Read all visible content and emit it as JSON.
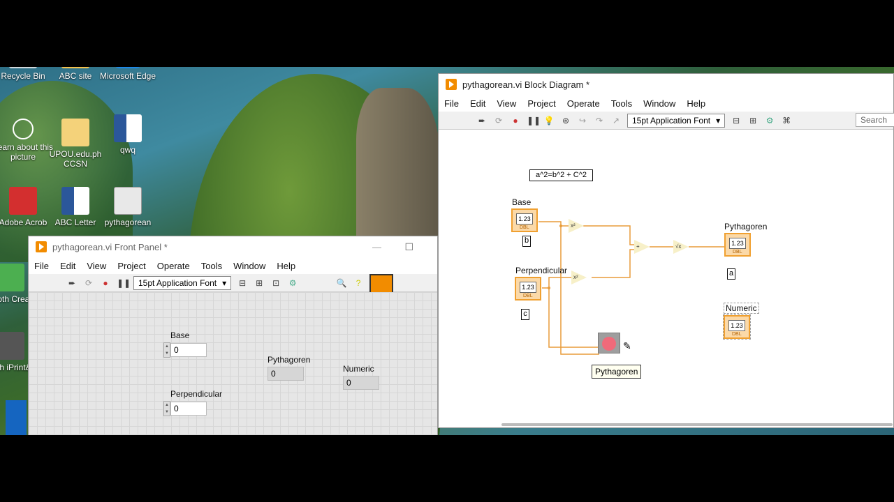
{
  "desktop": {
    "icons": [
      {
        "label": "Recycle Bin",
        "color": "#cfd8dc"
      },
      {
        "label": "ABC site",
        "color": "#f2c14e"
      },
      {
        "label": "Microsoft Edge",
        "color": "#1e88e5"
      },
      {
        "label": "Learn about this picture",
        "color": "#444444"
      },
      {
        "label": "UPOU.edu.ph CCSN",
        "color": "#f4d27a"
      },
      {
        "label": "qwq",
        "color": "#2b579a"
      },
      {
        "label": "Adobe Acrob",
        "color": "#d32f2f"
      },
      {
        "label": "ABC Letter",
        "color": "#2b579a"
      },
      {
        "label": "pythagorean",
        "color": "#e8e8e8"
      },
      {
        "label": "Broth Creat",
        "color": "#4caf50"
      },
      {
        "label": "Broth iPrint&S",
        "color": "#1565c0"
      }
    ]
  },
  "front_panel": {
    "title": "pythagorean.vi Front Panel *",
    "menu": [
      "File",
      "Edit",
      "View",
      "Project",
      "Operate",
      "Tools",
      "Window",
      "Help"
    ],
    "font_select": "15pt Application Font",
    "controls": {
      "base_label": "Base",
      "base_value": "0",
      "perp_label": "Perpendicular",
      "perp_value": "0",
      "pyth_label": "Pythagoren",
      "pyth_value": "0",
      "numeric_label": "Numeric",
      "numeric_value": "0"
    }
  },
  "block_diagram": {
    "title": "pythagorean.vi Block Diagram *",
    "menu": [
      "File",
      "Edit",
      "View",
      "Project",
      "Operate",
      "Tools",
      "Window",
      "Help"
    ],
    "font_select": "15pt Application Font",
    "search_placeholder": "Search",
    "formula_note": "a^2=b^2 + C^2",
    "base_label": "Base",
    "base_tag": "b",
    "perp_label": "Perpendicular",
    "perp_tag": "c",
    "pyth_label": "Pythagoren",
    "pyth_tag": "a",
    "numeric_label": "Numeric",
    "tooltip": "Pythagoren",
    "terminal_text": "1.23",
    "terminal_type": "DBL",
    "square_op": "x²",
    "add_op": "+",
    "sqrt_op": "√x",
    "wire_color": "#e89c3a"
  }
}
